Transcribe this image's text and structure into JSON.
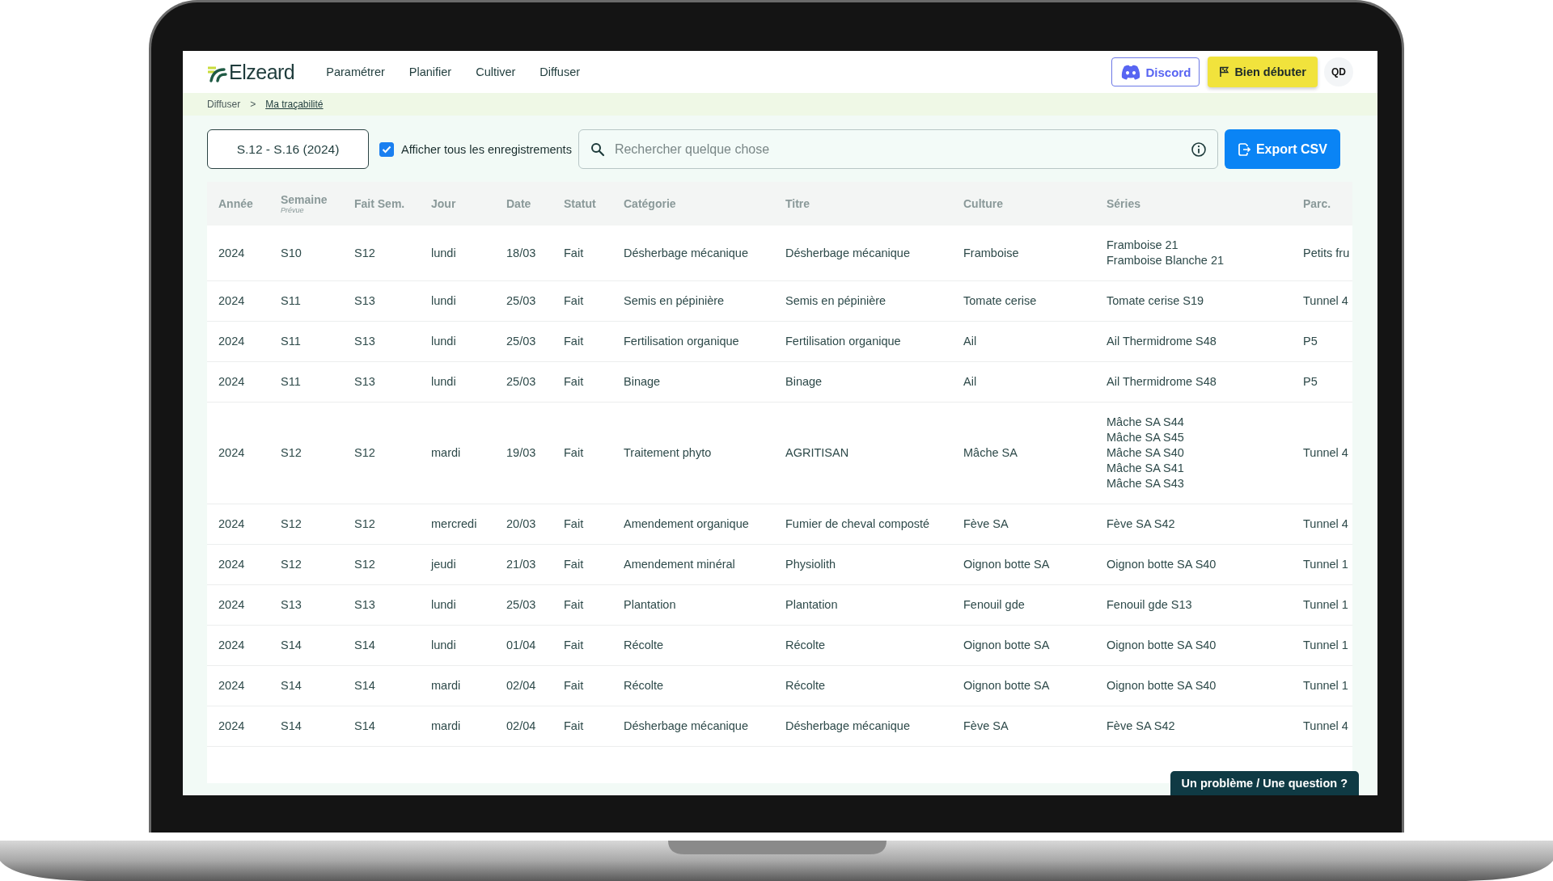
{
  "brand": "Elzeard",
  "nav": [
    {
      "label": "Paramétrer"
    },
    {
      "label": "Planifier"
    },
    {
      "label": "Cultiver"
    },
    {
      "label": "Diffuser"
    }
  ],
  "discord_button": "Discord",
  "start_button": "Bien débuter",
  "avatar": "QD",
  "breadcrumb": {
    "parent": "Diffuser",
    "separator": ">",
    "current": "Ma traçabilité"
  },
  "period": "S.12 - S.16 (2024)",
  "show_all": {
    "label": "Afficher tous les enregistrements",
    "checked": true
  },
  "search": {
    "placeholder": "Rechercher quelque chose"
  },
  "export_button": "Export CSV",
  "table": {
    "columns": [
      {
        "label": "Année"
      },
      {
        "label": "Semaine",
        "sublabel": "Prévue"
      },
      {
        "label": "Fait Sem."
      },
      {
        "label": "Jour"
      },
      {
        "label": "Date"
      },
      {
        "label": "Statut"
      },
      {
        "label": "Catégorie"
      },
      {
        "label": "Titre"
      },
      {
        "label": "Culture"
      },
      {
        "label": "Séries"
      },
      {
        "label": "Parc."
      }
    ],
    "rows": [
      {
        "cells": [
          "2024",
          "S10",
          "S12",
          "lundi",
          "18/03",
          "Fait",
          "Désherbage mécanique",
          "Désherbage mécanique",
          "Framboise",
          [
            "Framboise 21",
            "Framboise Blanche 21"
          ],
          "Petits fru"
        ]
      },
      {
        "cells": [
          "2024",
          "S11",
          "S13",
          "lundi",
          "25/03",
          "Fait",
          "Semis en pépinière",
          "Semis en pépinière",
          "Tomate cerise",
          [
            "Tomate cerise S19"
          ],
          "Tunnel 4"
        ]
      },
      {
        "cells": [
          "2024",
          "S11",
          "S13",
          "lundi",
          "25/03",
          "Fait",
          "Fertilisation organique",
          "Fertilisation organique",
          "Ail",
          [
            "Ail Thermidrome S48"
          ],
          "P5"
        ]
      },
      {
        "cells": [
          "2024",
          "S11",
          "S13",
          "lundi",
          "25/03",
          "Fait",
          "Binage",
          "Binage",
          "Ail",
          [
            "Ail Thermidrome S48"
          ],
          "P5"
        ]
      },
      {
        "cells": [
          "2024",
          "S12",
          "S12",
          "mardi",
          "19/03",
          "Fait",
          "Traitement phyto",
          "AGRITISAN",
          "Mâche SA",
          [
            "Mâche SA S44",
            "Mâche SA S45",
            "Mâche SA S40",
            "Mâche SA S41",
            "Mâche SA S43"
          ],
          "Tunnel 4"
        ]
      },
      {
        "cells": [
          "2024",
          "S12",
          "S12",
          "mercredi",
          "20/03",
          "Fait",
          "Amendement organique",
          "Fumier de cheval composté",
          "Fève SA",
          [
            "Fève SA S42"
          ],
          "Tunnel 4"
        ]
      },
      {
        "cells": [
          "2024",
          "S12",
          "S12",
          "jeudi",
          "21/03",
          "Fait",
          "Amendement minéral",
          "Physiolith",
          "Oignon botte SA",
          [
            "Oignon botte SA S40"
          ],
          "Tunnel 1"
        ]
      },
      {
        "cells": [
          "2024",
          "S13",
          "S13",
          "lundi",
          "25/03",
          "Fait",
          "Plantation",
          "Plantation",
          "Fenouil gde",
          [
            "Fenouil gde S13"
          ],
          "Tunnel 1"
        ]
      },
      {
        "cells": [
          "2024",
          "S14",
          "S14",
          "lundi",
          "01/04",
          "Fait",
          "Récolte",
          "Récolte",
          "Oignon botte SA",
          [
            "Oignon botte SA S40"
          ],
          "Tunnel 1"
        ]
      },
      {
        "cells": [
          "2024",
          "S14",
          "S14",
          "mardi",
          "02/04",
          "Fait",
          "Récolte",
          "Récolte",
          "Oignon botte SA",
          [
            "Oignon botte SA S40"
          ],
          "Tunnel 1"
        ]
      },
      {
        "cells": [
          "2024",
          "S14",
          "S14",
          "mardi",
          "02/04",
          "Fait",
          "Désherbage mécanique",
          "Désherbage mécanique",
          "Fève SA",
          [
            "Fève SA S42"
          ],
          "Tunnel 4"
        ]
      }
    ]
  },
  "help_button": "Un problème / Une question ?"
}
